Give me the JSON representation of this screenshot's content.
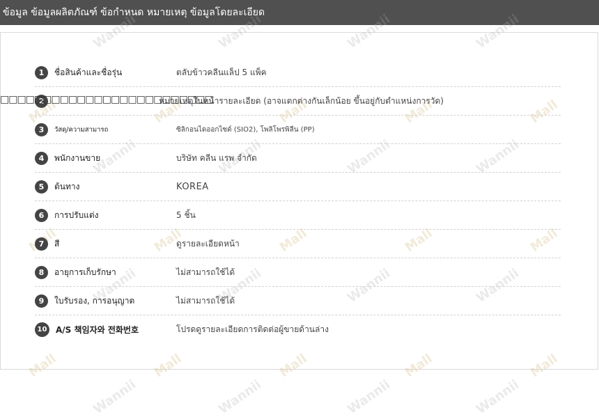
{
  "header": {
    "title": "ข้อมูล ข้อมูลผลิตภัณฑ์ ข้อกำหนด หมายเหตุ ข้อมูลโดยละเอียด"
  },
  "watermark": {
    "text": "Wannii",
    "text2": "Mall"
  },
  "overlay_boxes": "□□□□□□□□□□□□□□□□□□□□□□□□□",
  "rows": [
    {
      "num": "1",
      "label": "ชื่อสินค้าและชื่อรุ่น",
      "value": "ตลับข้าวคลีนแล็ป 5 แพ็ค"
    },
    {
      "num": "2",
      "label": "",
      "value": "หมายเหตุในหน้ารายละเอียด (อาจแตกต่างกันเล็กน้อย ขึ้นอยู่กับตำแหน่งการวัด)"
    },
    {
      "num": "3",
      "label": "วัสดุ/ความสามารถ",
      "value": "ซิลิกอนไดออกไซด์ (SIO2), โพลิโพรพิลีน (PP)"
    },
    {
      "num": "4",
      "label": "พนักงานขาย",
      "value": "บริษัท คลีน แรพ จำกัด"
    },
    {
      "num": "5",
      "label": "ต้นทาง",
      "value": "KOREA"
    },
    {
      "num": "6",
      "label": "การปรับแต่ง",
      "value": "5 ชิ้น"
    },
    {
      "num": "7",
      "label": "สี",
      "value": "ดูรายละเอียดหน้า"
    },
    {
      "num": "8",
      "label": "อายุการเก็บรักษา",
      "value": "ไม่สามารถใช้ได้"
    },
    {
      "num": "9",
      "label": "ใบรับรอง, การอนุญาต",
      "value": "ไม่สามารถใช้ได้"
    },
    {
      "num": "10",
      "label": "A/S 책임자와 전화번호",
      "value": "โปรดดูรายละเอียดการติดต่อผู้ขายด้านล่าง"
    }
  ]
}
